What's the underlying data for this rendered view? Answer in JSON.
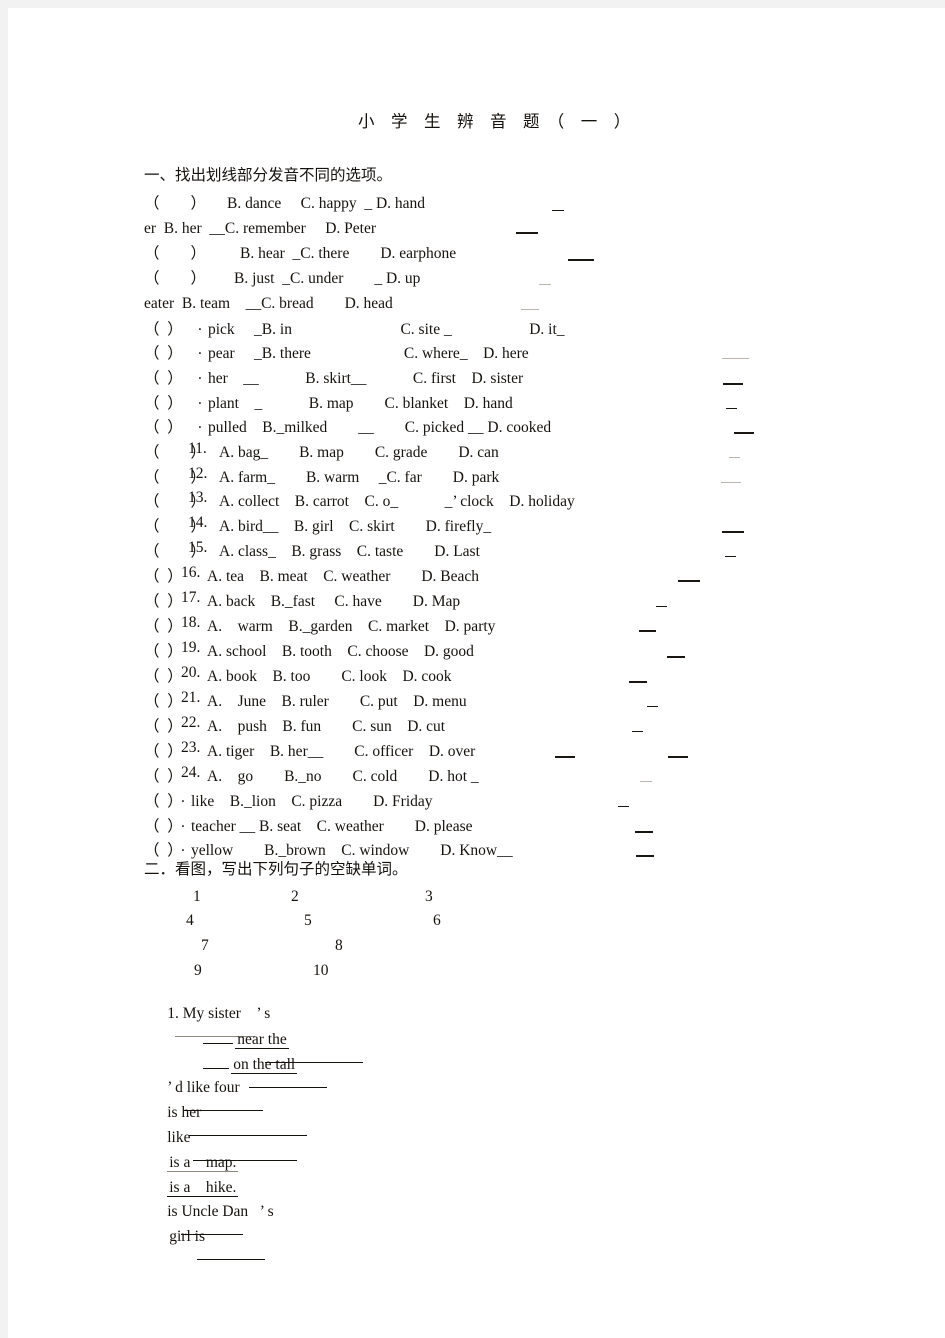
{
  "document": {
    "title": "小　学　生　辨　音　题　（　一　）"
  },
  "section1": {
    "heading": "一、找出划线部分发音不同的选项。",
    "questions": [
      {
        "bracket": "（　　）",
        "number": "",
        "options": "B. dance　 C. happy  _ D. hand"
      },
      {
        "bracket": "",
        "number": "",
        "options": "er  B. her  __C. remember　 D. Peter"
      },
      {
        "bracket": "（　　）",
        "number": "",
        "options": "B. hear  _C. there　　D. earphone"
      },
      {
        "bracket": "（　　）",
        "number": "",
        "options": "B. just  _C. under　　_ D. up"
      },
      {
        "bracket": "",
        "number": "",
        "options": "eater  B. team　__C. bread　　D. head"
      },
      {
        "bracket": "（  ）",
        "number": ".",
        "options": "pick　 _B. in　　　　　　　C. site _　　　　　D. it_"
      },
      {
        "bracket": "（  ）",
        "number": ".",
        "options": "pear　 _B. there　　　　　　C. where_　D. here"
      },
      {
        "bracket": "（  ）",
        "number": ".",
        "options": "her　__　　　B. skirt__　　　C. first　D. sister"
      },
      {
        "bracket": "（  ）",
        "number": ".",
        "options": "plant　_　　　B. map　　C. blanket　D. hand"
      },
      {
        "bracket": "（  ）",
        "number": ".",
        "options": "pulled　B._milked　　__　　C. picked __ D. cooked"
      },
      {
        "bracket": "（　　）",
        "number": "11.",
        "options": "A. bag_　　B. map　　C. grade　　D. can"
      },
      {
        "bracket": "（　　）",
        "number": "12.",
        "options": "A. farm_　　B. warm　 _C. far　　D. park"
      },
      {
        "bracket": "（　　）",
        "number": "13.",
        "options": "A. collect　B. carrot　C. o_　　　_’ clock　D. holiday"
      },
      {
        "bracket": "（　　）",
        "number": "14.",
        "options": "A. bird__　B. girl　C. skirt　　D. firefly_"
      },
      {
        "bracket": "（　　）",
        "number": "15.",
        "options": "A. class_　B. grass　C. taste　　D. Last"
      },
      {
        "bracket": "（  ）",
        "number": "16.",
        "options": "A. tea　B. meat　C. weather　　D. Beach"
      },
      {
        "bracket": "（  ）",
        "number": "17.",
        "options": "A. back　B._fast　 C. have　　D. Map"
      },
      {
        "bracket": "（  ）",
        "number": "18.",
        "options": "A.　warm　B._garden　C. market　D. party"
      },
      {
        "bracket": "（  ）",
        "number": "19.",
        "options": "A. school　B. tooth　C. choose　D. good"
      },
      {
        "bracket": "（  ）",
        "number": "20.",
        "options": "A. book　B. too　　C. look　D. cook"
      },
      {
        "bracket": "（  ）",
        "number": "21.",
        "options": "A.　June　B. ruler　　C. put　D. menu"
      },
      {
        "bracket": "（  ）",
        "number": "22.",
        "options": "A.　push　B. fun　　C. sun　D. cut"
      },
      {
        "bracket": "（  ）",
        "number": "23.",
        "options": "A. tiger　B. her__　　C. officer　D. over"
      },
      {
        "bracket": "（  ）",
        "number": "24.",
        "options": "A.　go　　B._no　　C. cold　　D. hot _"
      },
      {
        "bracket": "（  ）",
        "number": ".",
        "options": "like　B._lion　C. pizza　　D. Friday"
      },
      {
        "bracket": "（  ）",
        "number": ".",
        "options": "teacher __ B. seat　C. weather　　D. please"
      },
      {
        "bracket": "（  ）",
        "number": ".",
        "options": "yellow　　B._brown　C. window　　D. Know__"
      }
    ]
  },
  "section2": {
    "heading": "二．看图，写出下列句子的空缺单词。",
    "picture_numbers": [
      "1",
      "2",
      "3",
      "4",
      "5",
      "6",
      "7",
      "8",
      "9",
      "10"
    ],
    "sentences": [
      "1. My sister    ’ s",
      "near the",
      "on the tall",
      "’ d like four",
      "is her",
      "like",
      "is a    map.",
      "is a    hike.",
      "is Uncle Dan   ’ s",
      "girl is"
    ]
  },
  "colors": {
    "page_background": "#ffffff",
    "viewport_background": "#f2f2f2",
    "ink": "#16120e"
  }
}
